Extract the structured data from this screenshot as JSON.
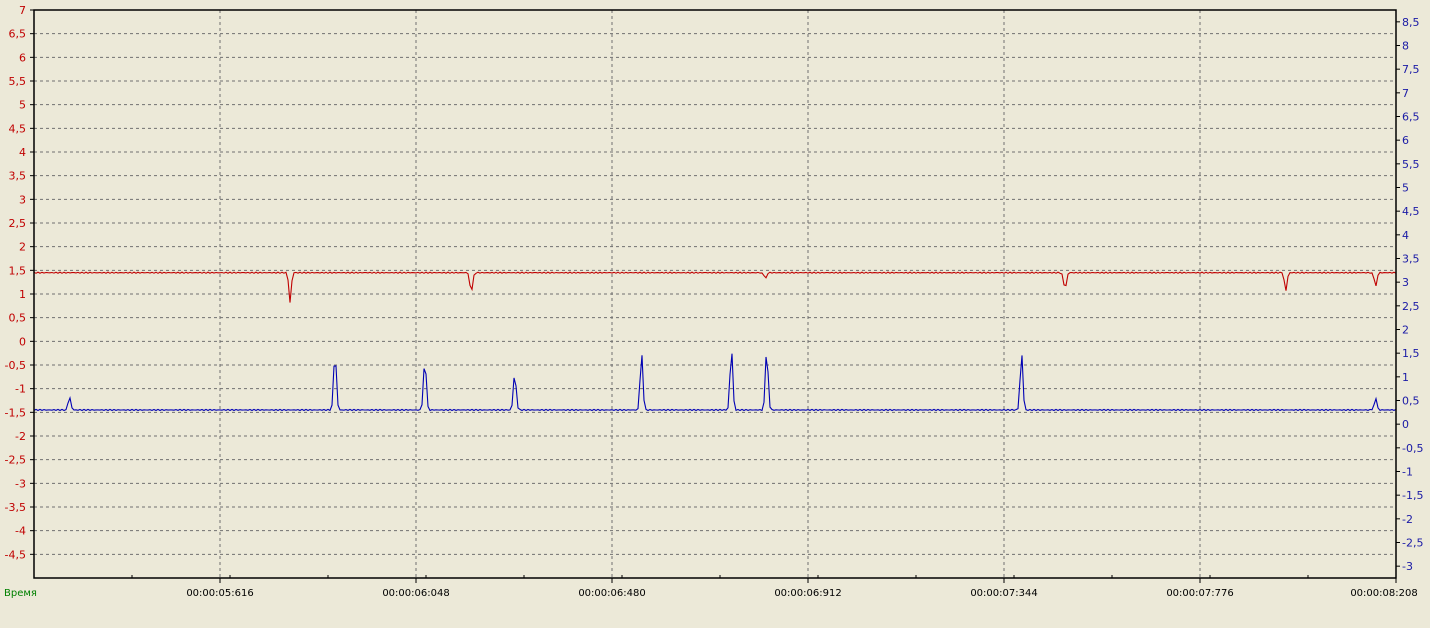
{
  "chart_data": {
    "type": "line",
    "xlabel": "Время",
    "x_ticks": [
      "00:00:05:616",
      "00:00:06:048",
      "00:00:06:480",
      "00:00:06:912",
      "00:00:07:344",
      "00:00:07:776",
      "00:00:08:208"
    ],
    "y_left": {
      "min": -5,
      "max": 7,
      "step": 0.5,
      "color": "#c00000",
      "labels": [
        "7",
        "6,5",
        "6",
        "5,5",
        "5",
        "4,5",
        "4",
        "3,5",
        "3",
        "2,5",
        "2",
        "1,5",
        "1",
        "0,5",
        "0",
        "-0,5",
        "-1",
        "-1,5",
        "-2",
        "-2,5",
        "-3",
        "-3,5",
        "-4",
        "-4,5"
      ]
    },
    "y_right": {
      "min": -3.25,
      "max": 8.75,
      "step": 0.5,
      "color": "#1a1aa6",
      "labels": [
        "8,5",
        "8",
        "7,5",
        "7",
        "6,5",
        "6",
        "5,5",
        "5",
        "4,5",
        "4",
        "3,5",
        "3",
        "2,5",
        "2",
        "1,5",
        "1",
        "0,5",
        "0",
        "-0,5",
        "-1",
        "-1,5",
        "-2",
        "-2,5",
        "-3"
      ]
    },
    "grid": true,
    "series": [
      {
        "axis": "left",
        "color": "#c00000",
        "baseline": 1.45,
        "events": [
          [
            0.188,
            0.8
          ],
          [
            0.321,
            0.9
          ],
          [
            0.537,
            1.3
          ],
          [
            0.757,
            0.98
          ],
          [
            0.919,
            1.0
          ],
          [
            0.985,
            1.1
          ]
        ]
      },
      {
        "axis": "right",
        "color": "#0000b4",
        "baseline": 0.3,
        "events": [
          [
            0.026,
            0.65
          ],
          [
            0.221,
            1.95
          ],
          [
            0.287,
            1.75
          ],
          [
            0.353,
            1.35
          ],
          [
            0.446,
            1.85
          ],
          [
            0.512,
            2.0
          ],
          [
            0.538,
            2.0
          ],
          [
            0.725,
            1.85
          ],
          [
            0.985,
            0.6
          ]
        ]
      }
    ]
  }
}
